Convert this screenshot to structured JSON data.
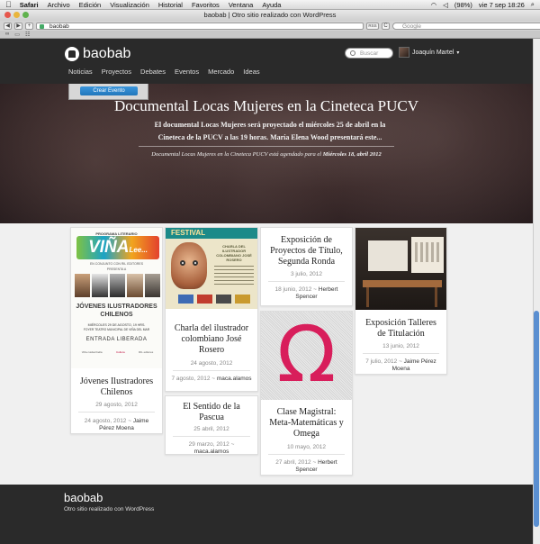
{
  "menubar": {
    "items": [
      "Safari",
      "Archivo",
      "Edición",
      "Visualización",
      "Historial",
      "Favoritos",
      "Ventana",
      "Ayuda"
    ],
    "battery": "(98%)",
    "clock": "vie 7 sep  18:26"
  },
  "window": {
    "title": "baobab | Otro sitio realizado con WordPress"
  },
  "toolbar": {
    "url": "baobab",
    "reload": "C",
    "rss": "RSS",
    "search_placeholder": "Google"
  },
  "site": {
    "logo": "baobab",
    "nav": [
      "Noticias",
      "Proyectos",
      "Debates",
      "Eventos",
      "Mercado",
      "Ideas"
    ],
    "search_placeholder": "Buscar",
    "user_name": "Joaquín Martel",
    "user_chevron": "▾"
  },
  "create_event": {
    "label": "Crear Evento"
  },
  "hero": {
    "title": "Documental Locas Mujeres en la Cineteca PUCV",
    "description": "El documental Locas Mujeres será proyectado el miércoles 25 de abril en la Cineteca de la PUCV a las 19 horas. María Elena Wood presentará este...",
    "meta_prefix": "Documental Locas Mujeres en la Cineteca PUCV está agendado para el",
    "meta_date": "Miércoles 18, abril 2012"
  },
  "cards": [
    {
      "title": "Jóvenes Ilustradores Chilenos",
      "date": "29 agosto, 2012",
      "meta_date": "24 agosto, 2012",
      "author": "Jaime Pérez Moena"
    },
    {
      "title": "Charla del ilustrador colombiano José Rosero",
      "date": "24 agosto, 2012",
      "meta_date": "7 agosto, 2012",
      "author": "maca.alamos"
    },
    {
      "title": "El Sentido de la Pascua",
      "date": "25 abril, 2012",
      "meta_date": "29 marzo, 2012",
      "author": "maca.alamos"
    },
    {
      "title": "Exposición de Proyectos de Título, Segunda Ronda",
      "date": "3 julio, 2012",
      "meta_date": "18 junio, 2012",
      "author": "Herbert Spencer"
    },
    {
      "title": "Clase Magistral: Meta-Matemáticas y Omega",
      "date": "10 mayo, 2012",
      "meta_date": "27 abril, 2012",
      "author": "Herbert Spencer"
    },
    {
      "title": "Exposición Talleres de Titulación",
      "date": "13 junio, 2012",
      "meta_date": "7 julio, 2012",
      "author": "Jaime Pérez Moena"
    }
  ],
  "meta_sep": "~",
  "poster1": {
    "top": "PROGRAMA LITERARIO",
    "brand": "VIÑA",
    "brand2": "Lee...",
    "sub": "EN CONJUNTO CON RIL EDITORES",
    "presents": "PRESENTA A",
    "heading1": "JÓVENES ILUSTRADORES",
    "heading2": "CHILENOS",
    "when": "MIÉRCOLES 29 DE AGOSTO, 19 HRS.",
    "where": "FOYER TEATRO MUNICIPAL DE VIÑA DEL MAR",
    "free": "ENTRADA LIBERADA",
    "logos": [
      "Viña cuidad bella",
      "Cultura",
      "RIL editores"
    ]
  },
  "poster2": {
    "top": "FESTIVAL",
    "title": "CHARLA DEL ILUSTRADOR COLOMBIANO JOSÉ ROSERO"
  },
  "omega": {
    "glyph": "Ω"
  },
  "footer": {
    "logo": "baobab",
    "text": "Otro sitio realizado con WordPress"
  }
}
